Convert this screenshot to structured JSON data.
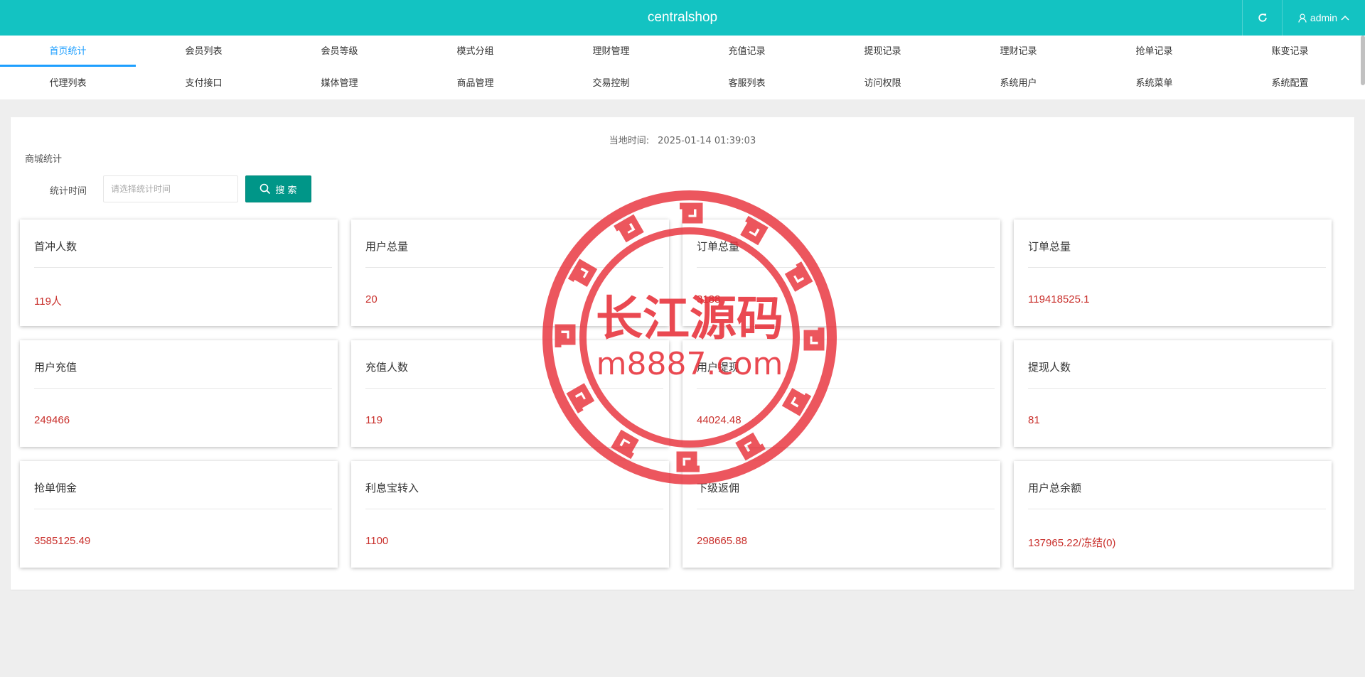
{
  "header": {
    "app_title": "centralshop",
    "refresh_icon": "refresh-icon",
    "user_name": "admin",
    "user_icon": "user-icon",
    "caret_icon": "chevron-up-icon"
  },
  "nav": {
    "row1": [
      "首页统计",
      "会员列表",
      "会员等级",
      "模式分组",
      "理财管理",
      "充值记录",
      "提现记录",
      "理财记录",
      "抢单记录",
      "账变记录"
    ],
    "row2": [
      "代理列表",
      "支付接口",
      "媒体管理",
      "商品管理",
      "交易控制",
      "客服列表",
      "访问权限",
      "系统用户",
      "系统菜单",
      "系统配置"
    ],
    "active_index": 0
  },
  "main": {
    "local_time_label": "当地时间:",
    "local_time_value": "2025-01-14 01:39:03",
    "section_title": "商城统计",
    "search": {
      "label": "统计时间",
      "placeholder": "请选择统计时间",
      "value": "",
      "button_label": "搜 索",
      "button_icon": "search-icon"
    }
  },
  "cards": [
    {
      "title": "首冲人数",
      "value": "119人"
    },
    {
      "title": "用户总量",
      "value": "20"
    },
    {
      "title": "订单总量",
      "value": "3188"
    },
    {
      "title": "订单总量",
      "value": "119418525.1"
    },
    {
      "title": "用户充值",
      "value": "249466"
    },
    {
      "title": "充值人数",
      "value": "119"
    },
    {
      "title": "用户提现",
      "value": "44024.48"
    },
    {
      "title": "提现人数",
      "value": "81"
    },
    {
      "title": "抢单佣金",
      "value": "3585125.49"
    },
    {
      "title": "利息宝转入",
      "value": "1100"
    },
    {
      "title": "下级返佣",
      "value": "298665.88"
    },
    {
      "title": "用户总余额",
      "value": "137965.22/冻结(0)"
    }
  ],
  "watermark": {
    "line1": "长江源码",
    "line2": "m8887.com",
    "color": "#e8313a"
  },
  "colors": {
    "header_bg": "#13c3c2",
    "active_nav": "#1e9fff",
    "search_btn": "#009688",
    "value_text": "#c9302c"
  }
}
